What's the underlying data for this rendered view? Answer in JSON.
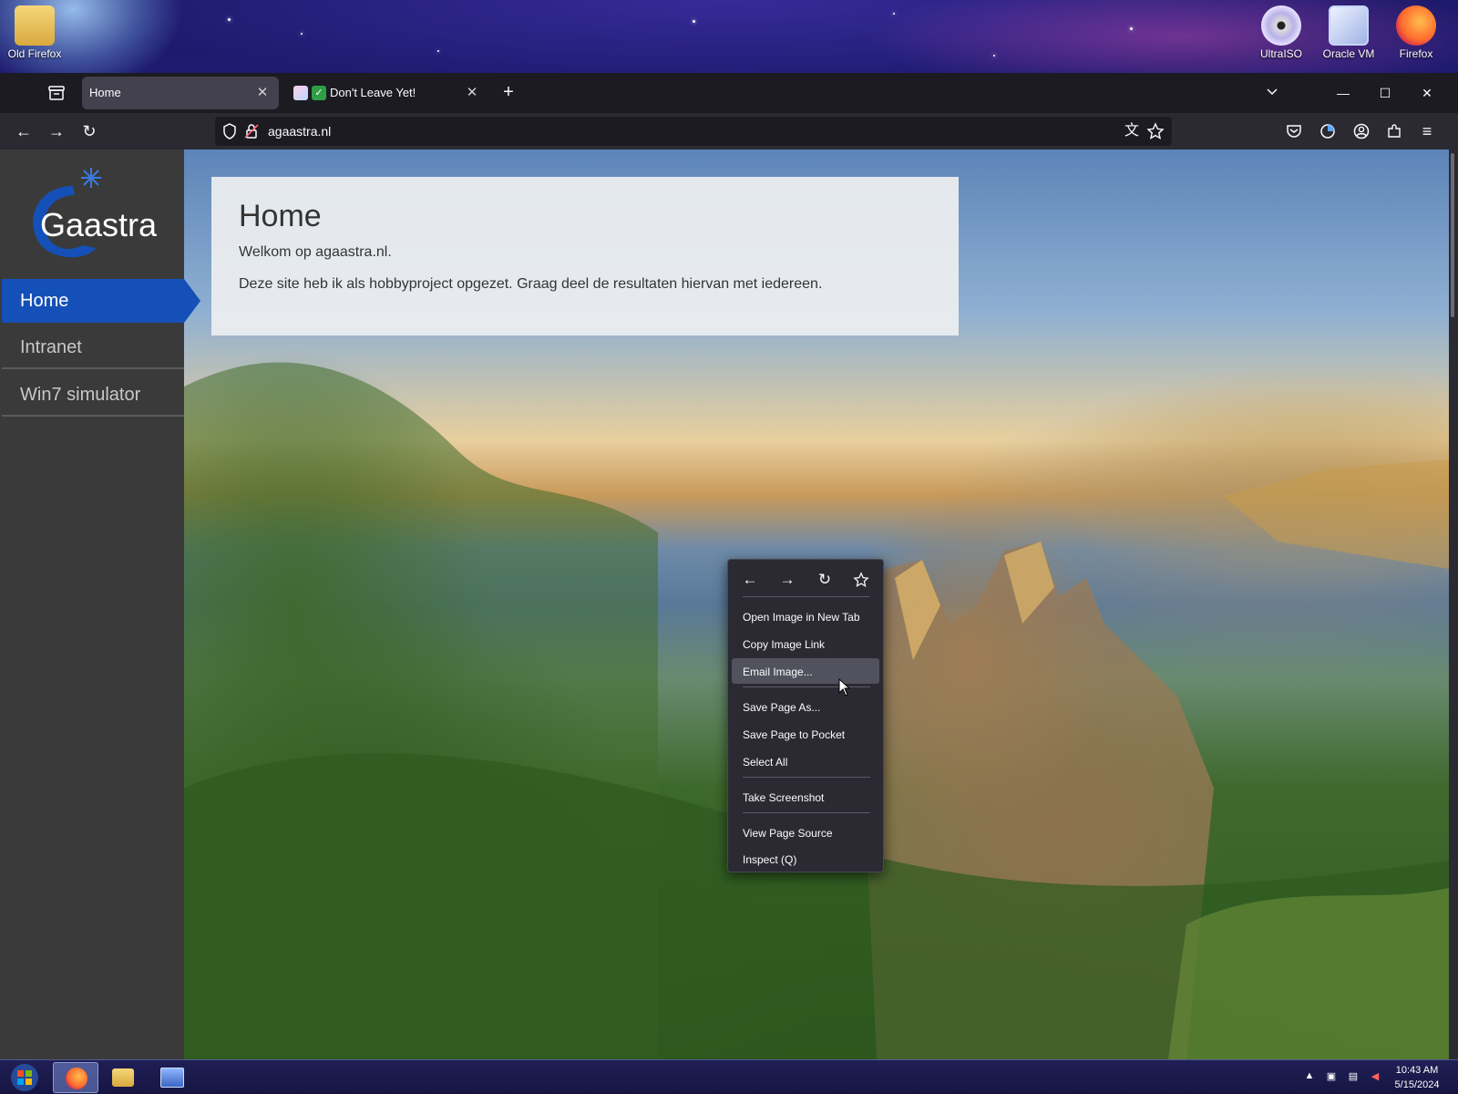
{
  "desktop": {
    "icons": [
      {
        "label": "Old Firefox"
      },
      {
        "label": "UltraISO"
      },
      {
        "label": "Oracle VM"
      },
      {
        "label": "Firefox"
      }
    ]
  },
  "browser": {
    "tabs": [
      {
        "title": "Home",
        "active": true
      },
      {
        "title": "Don't Leave Yet!",
        "active": false
      }
    ],
    "url": "agaastra.nl"
  },
  "site": {
    "logo_text": "Gaastra",
    "menu": [
      {
        "label": "Home",
        "active": true
      },
      {
        "label": "Intranet",
        "active": false
      },
      {
        "label": "Win7 simulator",
        "active": false
      }
    ],
    "card": {
      "heading": "Home",
      "welcome": "Welkom op agaastra.nl.",
      "body": "Deze site heb ik als hobbyproject opgezet. Graag deel de resultaten hiervan met iedereen."
    }
  },
  "context_menu": {
    "items": [
      {
        "label": "Open Image in New Tab"
      },
      {
        "label": "Copy Image Link"
      },
      {
        "label": "Email Image...",
        "hovered": true
      },
      {
        "label": "Save Page As..."
      },
      {
        "label": "Save Page to Pocket"
      },
      {
        "label": "Select All"
      },
      {
        "label": "Take Screenshot"
      },
      {
        "label": "View Page Source"
      },
      {
        "label": "Inspect (Q)"
      }
    ]
  },
  "taskbar": {
    "time": "10:43 AM",
    "date": "5/15/2024"
  },
  "colors": {
    "accent": "#1450b8",
    "sidebar": "#3a3a3a",
    "browser_chrome": "#2b2a33"
  }
}
